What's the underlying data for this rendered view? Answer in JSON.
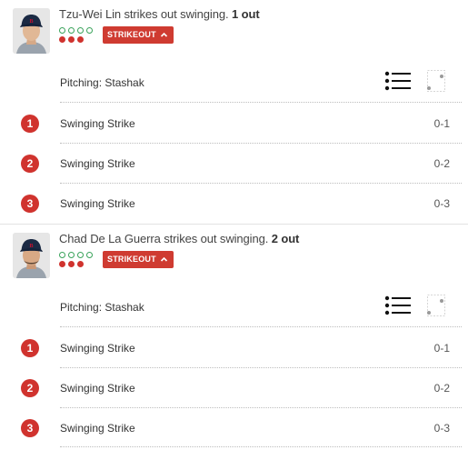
{
  "plays": [
    {
      "batter": "Tzu-Wei Lin",
      "description": "Tzu-Wei Lin strikes out swinging.",
      "outs": "1 out",
      "badge": "STRIKEOUT",
      "pitching": "Pitching: Stashak",
      "count_dots": {
        "balls_shown": 4,
        "strikes_shown": 3
      },
      "pitches": [
        {
          "number": "1",
          "type": "Swinging Strike",
          "count": "0-1"
        },
        {
          "number": "2",
          "type": "Swinging Strike",
          "count": "0-2"
        },
        {
          "number": "3",
          "type": "Swinging Strike",
          "count": "0-3"
        }
      ]
    },
    {
      "batter": "Chad De La Guerra",
      "description": "Chad De La Guerra strikes out swinging.",
      "outs": "2 out",
      "badge": "STRIKEOUT",
      "pitching": "Pitching: Stashak",
      "count_dots": {
        "balls_shown": 4,
        "strikes_shown": 3
      },
      "pitches": [
        {
          "number": "1",
          "type": "Swinging Strike",
          "count": "0-1"
        },
        {
          "number": "2",
          "type": "Swinging Strike",
          "count": "0-2"
        },
        {
          "number": "3",
          "type": "Swinging Strike",
          "count": "0-3"
        }
      ]
    }
  ],
  "colors": {
    "accent_red": "#cf3b31",
    "strike_dot": "#d0332e",
    "ball_dot": "#3aa35b",
    "cap_navy": "#1b2a44"
  },
  "icons": {
    "list_view": "list-icon",
    "strike_zone": "strike-zone-icon",
    "expand": "chevron-up-icon"
  }
}
